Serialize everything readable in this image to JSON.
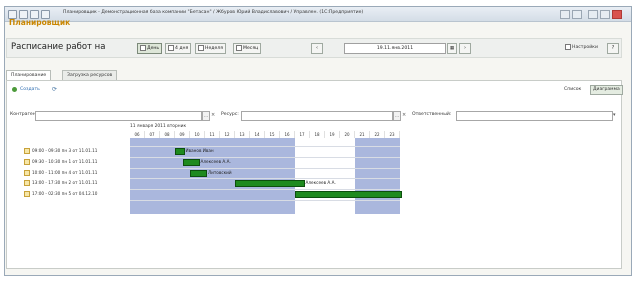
{
  "window": {
    "title": "Планировщик - Демонстрационная база компании \"Бетасан\" / Жбуров Юрий Владиславович / Управлен. (1С:Предприятие)"
  },
  "heading": "Планировщик",
  "toolbar": {
    "schedule_label": "Расписание работ на",
    "period_day": "День",
    "period_4days": "4 дня",
    "period_week": "Неделя",
    "period_month": "Месяц",
    "date": "19.11.янв.2011",
    "settings": "Настройки"
  },
  "tabs": [
    "Планирование",
    "Загрузка ресурсов"
  ],
  "actions": {
    "create": "Создать",
    "list": "Список",
    "load": "Диаграмма"
  },
  "filters": {
    "contractor": "Контрагент:",
    "resource": "Ресурс:",
    "responsible": "Ответственный:"
  },
  "gantt": {
    "date_header": "11 января 2011 вторник",
    "hours": [
      "06",
      "07",
      "08",
      "09",
      "10",
      "11",
      "12",
      "13",
      "14",
      "15",
      "16",
      "17",
      "18",
      "19",
      "20",
      "21",
      "22",
      "23"
    ],
    "rows": [
      {
        "label": "09:00 - 09:30 пн 3 от 11.01.11",
        "bar_label": "Иванов Иван"
      },
      {
        "label": "09:30 - 10:30 пн 1 от 11.01.11",
        "bar_label": "Алексеев А.А."
      },
      {
        "label": "10:00 - 11:00 пн 4 от 11.01.11",
        "bar_label": "Литовский"
      },
      {
        "label": "13:00 - 17:30 пн 2 от 11.01.11",
        "bar_label": "Алексеев А.А."
      },
      {
        "label": "17:00 - 02:30 пн 5 от 04.12.10",
        "bar_label": ""
      }
    ]
  },
  "colors": {
    "heading": "#c98600",
    "bar": "#1e8a1e",
    "nonworking": "#aab7dd"
  }
}
